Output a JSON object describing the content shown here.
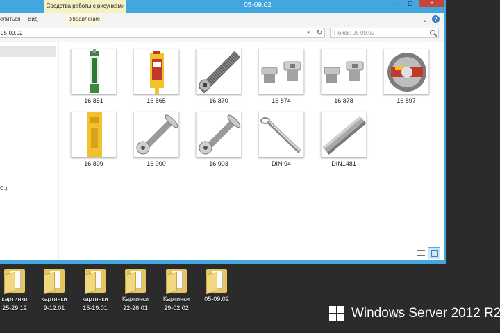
{
  "window": {
    "title": "05-09.02",
    "context_tab": "Средства работы с рисунками",
    "minimize": "—",
    "maximize": "▢",
    "close": "✕"
  },
  "ribbon": {
    "tabs": [
      "елиться",
      "Вид",
      "Управление"
    ],
    "expand": "⌄",
    "help": "?"
  },
  "address": {
    "path": "05-09.02",
    "dropdown": "▾",
    "refresh": "↻"
  },
  "search": {
    "placeholder": "Поиск: 05-09.02"
  },
  "nav": {
    "drive_label": "C:)"
  },
  "files": [
    {
      "label": "16 851",
      "icon": "sealant-tube"
    },
    {
      "label": "16 865",
      "icon": "glue-tube"
    },
    {
      "label": "16 870",
      "icon": "set-screw"
    },
    {
      "label": "16 874",
      "icon": "plug-screws"
    },
    {
      "label": "16 878",
      "icon": "plug-screws"
    },
    {
      "label": "16 897",
      "icon": "tape-roll"
    },
    {
      "label": "16 899",
      "icon": "yellow-package"
    },
    {
      "label": "16 900",
      "icon": "button-head-screw"
    },
    {
      "label": "16 903",
      "icon": "button-head-screw"
    },
    {
      "label": "DIN 94",
      "icon": "cotter-pin"
    },
    {
      "label": "DIN1481",
      "icon": "spring-pin"
    }
  ],
  "desktop_folders": [
    {
      "line1": "картинки",
      "line2": "25-29.12"
    },
    {
      "line1": "картинки",
      "line2": "9-12.01"
    },
    {
      "line1": "картинки",
      "line2": "15-19.01"
    },
    {
      "line1": "Картинки",
      "line2": "22-26.01"
    },
    {
      "line1": "Картинки",
      "line2": "29-02.02"
    },
    {
      "line1": "05-09.02",
      "line2": ""
    }
  ],
  "branding": {
    "text": "Windows Server 2012 R2",
    "watermark": "ow"
  },
  "colors": {
    "window_frame": "#43a6de",
    "context_tab": "#f6f1c4",
    "close_button": "#c7463b",
    "desktop": "#2b2b2b"
  }
}
